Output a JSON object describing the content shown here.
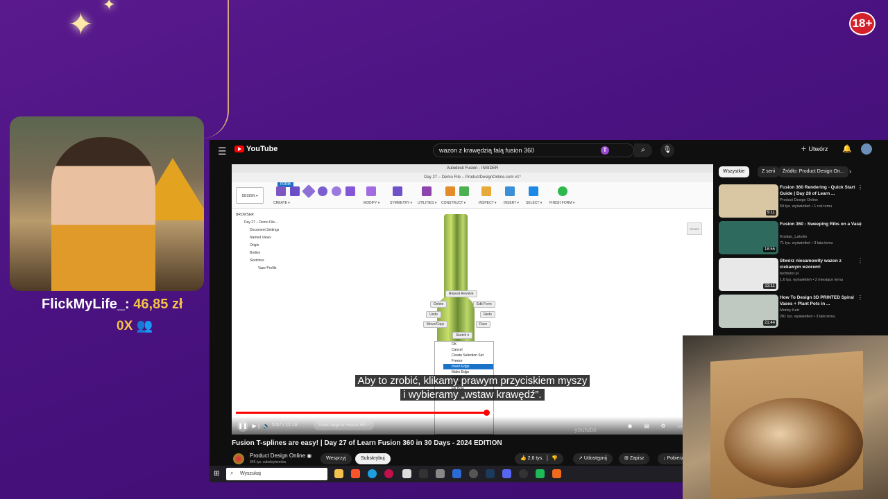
{
  "overlay": {
    "badge": "18+",
    "streamer_donor": "FlickMyLife_:",
    "donation_amount": "46,85 zł",
    "secondary": "0X 👥"
  },
  "youtube": {
    "search_value": "wazon z krawędzią falą fusion 360",
    "create_label": "Utwórz",
    "logo_text": "YouTube",
    "video": {
      "app_title": "Autodesk Fusion - INSIDER",
      "file_tab": "Day 27 – Demo File – ProductDesignOnline.com v1*",
      "design_label": "DESIGN ▾",
      "form_tab": "FORM",
      "toolbar_groups": [
        "CREATE ▾",
        "MODIFY ▾",
        "SYMMETRY ▾",
        "UTILITIES ▾",
        "CONSTRUCT ▾",
        "INSPECT ▾",
        "INSERT ▾",
        "SELECT ▾",
        "FINISH FORM ▾"
      ],
      "browser_header": "BROWSER",
      "browser_items": [
        "Day 27 – Demo File...",
        "Document Settings",
        "Named Views",
        "Origin",
        "Bodies",
        "Sketches",
        "Vase Profile"
      ],
      "marking_menu": [
        "Repeat Revolve",
        "Delete",
        "Edit Form",
        "Undo",
        "Redo",
        "Move/Copy",
        "Face",
        "Sketch ▾"
      ],
      "context_menu": [
        "OK",
        "Cancel",
        "Create Selection Set",
        "Freeze",
        "Insert Edge",
        "Make Edge",
        "Flatten",
        "Match",
        "Fill Hole"
      ],
      "viewcube": "FRONT",
      "subtitle_line1": "Aby to zrobić, klikamy prawym przyciskiem myszy",
      "subtitle_line2": "i wybieramy „wstaw krawędź”.",
      "time": "5:57 / 11:16",
      "chapter": "Insert edge in Fusion 360 ›",
      "watermark": "youtube",
      "progress": 0.53
    },
    "title": "Fusion T-splines are easy! | Day 27 of Learn Fusion 360 in 30 Days - 2024 EDITION",
    "channel": "Product Design Online",
    "subscribers": "349 tys. subskrybentów",
    "join": "Wesprzyj",
    "subscribe": "Subskrybuj",
    "likes": "2,6 tys.",
    "share": "Udostępnij",
    "save": "Zapisz",
    "download": "Pobierz",
    "chips": [
      "Wszystkie",
      "Z serii",
      "Źródło: Product Design On..."
    ],
    "recommendations": [
      {
        "title": "Fusion 360 Rendering - Quick Start Guide | Day 28 of Learn ...",
        "channel": "Product Design Online",
        "meta": "59 tys. wyświetleń • 1 rok temu",
        "duration": "9:11",
        "color": "#d9c7a3"
      },
      {
        "title": "Fusion 360 - Sweeping Ribs on a Vase",
        "channel": "Kristian_Laholm",
        "meta": "71 tys. wyświetleń • 3 lata temu",
        "duration": "18:55",
        "color": "#2e6b5e"
      },
      {
        "title": "Stwórz niesamowity wazon z ciekawym wzorem!",
        "channel": "techtutor.pl",
        "meta": "1,6 tys. wyświetleń • 2 miesiące temu",
        "duration": "13:11",
        "color": "#e8e8e8"
      },
      {
        "title": "How To Design 3D PRINTED Spiral Vases + Plant Pots in ...",
        "channel": "Morley Kert",
        "meta": "281 tys. wyświetleń • 3 lata temu",
        "duration": "21:44",
        "color": "#bfc9c2"
      }
    ]
  },
  "taskbar": {
    "search_placeholder": "Wyszukaj"
  }
}
